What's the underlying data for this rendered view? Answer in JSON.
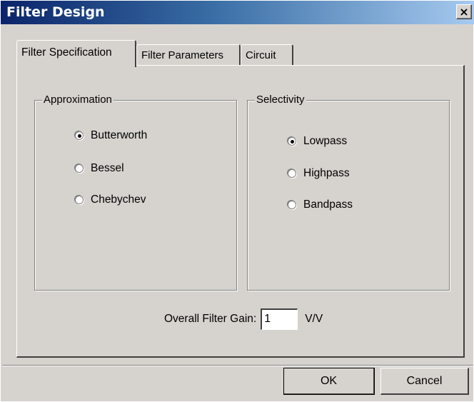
{
  "window": {
    "title": "Filter Design",
    "close_glyph": "×"
  },
  "tabs": [
    {
      "label": "Filter Specification",
      "active": true
    },
    {
      "label": "Filter Parameters",
      "active": false
    },
    {
      "label": "Circuit",
      "active": false
    }
  ],
  "approximation": {
    "legend": "Approximation",
    "options": [
      {
        "label": "Butterworth",
        "checked": true
      },
      {
        "label": "Bessel",
        "checked": false
      },
      {
        "label": "Chebychev",
        "checked": false
      }
    ]
  },
  "selectivity": {
    "legend": "Selectivity",
    "options": [
      {
        "label": "Lowpass",
        "checked": true
      },
      {
        "label": "Highpass",
        "checked": false
      },
      {
        "label": "Bandpass",
        "checked": false
      }
    ]
  },
  "gain": {
    "label": "Overall Filter Gain:",
    "value": "1",
    "unit": "V/V"
  },
  "buttons": {
    "ok": "OK",
    "cancel": "Cancel"
  },
  "colors": {
    "title_bar_start": "#0a246a",
    "title_bar_end": "#a6caf0",
    "face": "#d6d3ce"
  }
}
